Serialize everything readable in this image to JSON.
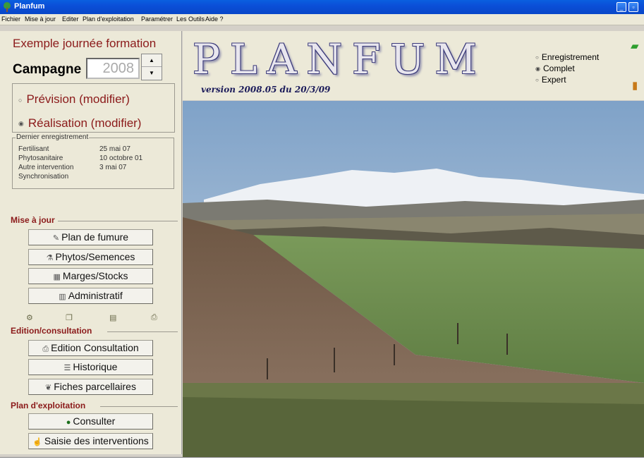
{
  "window": {
    "title": "Planfum"
  },
  "menu": [
    "Fichier",
    "Mise à jour",
    "Editer",
    "Plan d'exploitation",
    "Paramétrer",
    "Les Outils",
    "Aide ?"
  ],
  "org_title": "Exemple journée formation",
  "campagne": {
    "label": "Campagne",
    "year": "2008"
  },
  "modes": {
    "prevision": "Prévision  (modifier)",
    "realisation": "Réalisation  (modifier)",
    "selected": "realisation"
  },
  "last_record": {
    "legend": "Dernier enregistrement",
    "rows": [
      {
        "label": "Fertilisant",
        "value": "25 mai 07"
      },
      {
        "label": "Phytosanitaire",
        "value": "10 octobre 01"
      },
      {
        "label": "Autre intervention",
        "value": "3 mai 07"
      },
      {
        "label": "Synchronisation",
        "value": ""
      }
    ]
  },
  "sections": {
    "mise_a_jour": {
      "title": "Mise à jour",
      "buttons": [
        "Plan de fumure",
        "Phytos/Semences",
        "Marges/Stocks",
        "Administratif"
      ]
    },
    "edition": {
      "title": "Edition/consultation",
      "buttons": [
        "Edition Consultation",
        "Historique",
        "Fiches parcellaires"
      ]
    },
    "plan": {
      "title": "Plan d'exploitation",
      "buttons": [
        "Consulter",
        "Saisie des interventions"
      ]
    }
  },
  "brand": {
    "name": "PLANFUM",
    "version": "version 2008.05  du 20/3/09"
  },
  "display_modes": {
    "options": [
      "Enregistrement",
      "Complet",
      "Expert"
    ],
    "selected": "Complet"
  },
  "icons": {
    "app": "tree-icon",
    "buttons": [
      "pencil-icon",
      "flask-icon",
      "calculator-icon",
      "book-icon",
      "globe-icon"
    ]
  }
}
